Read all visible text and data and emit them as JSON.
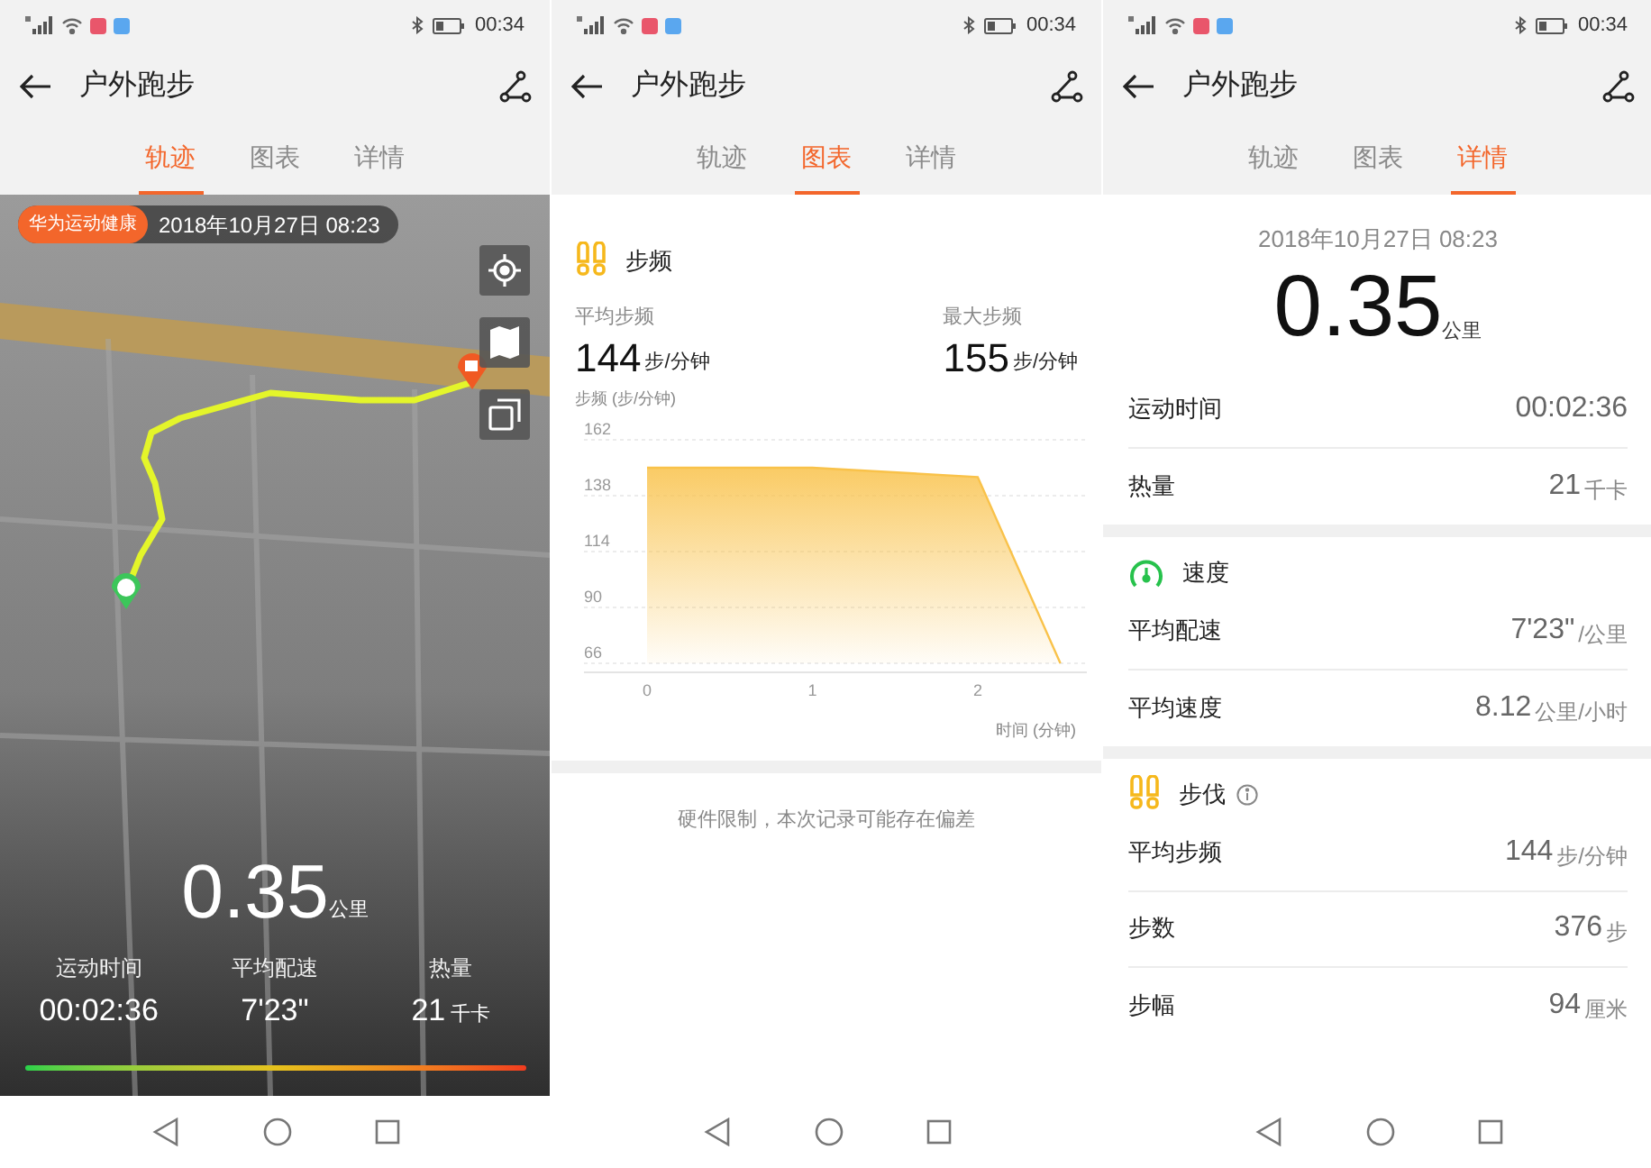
{
  "screens": [
    {
      "kind": "map",
      "status_bar": {
        "time": "00:34"
      },
      "header": {
        "title": "户外跑步"
      },
      "tabs": [
        {
          "label": "轨迹",
          "selected": true
        },
        {
          "label": "图表",
          "selected": false
        },
        {
          "label": "详情",
          "selected": false
        }
      ],
      "badge": "华为运动健康",
      "date": "2018年10月27日 08:23",
      "distance": "0.35",
      "distance_unit": "公里",
      "stats": [
        {
          "label": "运动时间",
          "value": "00:02:36"
        },
        {
          "label": "平均配速",
          "value": "7'23\""
        },
        {
          "label": "热量",
          "value": "21",
          "unit": "千卡"
        }
      ]
    },
    {
      "kind": "chart",
      "status_bar": {
        "time": "00:34"
      },
      "header": {
        "title": "户外跑步"
      },
      "tabs": [
        {
          "label": "轨迹",
          "selected": false
        },
        {
          "label": "图表",
          "selected": true
        },
        {
          "label": "详情",
          "selected": false
        }
      ],
      "section": {
        "title": "步频",
        "stats": [
          {
            "label": "平均步频",
            "value": "144",
            "unit": "步/分钟"
          },
          {
            "label": "最大步频",
            "value": "155",
            "unit": "步/分钟"
          }
        ],
        "chart_data": {
          "type": "area",
          "ylabel": "步频 (步/分钟)",
          "xlabel": "时间 (分钟)",
          "x": [
            0,
            1,
            2,
            2.5
          ],
          "series": [
            {
              "color": "#f9c24a",
              "values": [
                150,
                150,
                146,
                66
              ]
            }
          ],
          "xlim": [
            0,
            2.66
          ],
          "ylim": [
            66,
            162
          ],
          "xticks": [
            0,
            1,
            2
          ],
          "yticks": [
            66,
            90,
            114,
            138,
            162
          ],
          "grid": true
        }
      },
      "note": "硬件限制，本次记录可能存在偏差"
    },
    {
      "kind": "details",
      "status_bar": {
        "time": "00:34"
      },
      "header": {
        "title": "户外跑步"
      },
      "tabs": [
        {
          "label": "轨迹",
          "selected": false
        },
        {
          "label": "图表",
          "selected": false
        },
        {
          "label": "详情",
          "selected": true
        }
      ],
      "date": "2018年10月27日 08:23",
      "distance": "0.35",
      "distance_unit": "公里",
      "groups": [
        {
          "kind": "plain",
          "rows": [
            {
              "label": "运动时间",
              "value": "00:02:36"
            },
            {
              "label": "热量",
              "value": "21",
              "unit": "千卡"
            }
          ]
        },
        {
          "kind": "speed",
          "title": "速度",
          "rows": [
            {
              "label": "平均配速",
              "value": "7'23\"",
              "unit": "/公里"
            },
            {
              "label": "平均速度",
              "value": "8.12",
              "unit": "公里/小时"
            }
          ]
        },
        {
          "kind": "steps",
          "title": "步伐",
          "info": true,
          "rows": [
            {
              "label": "平均步频",
              "value": "144",
              "unit": "步/分钟"
            },
            {
              "label": "步数",
              "value": "376",
              "unit": "步"
            },
            {
              "label": "步幅",
              "value": "94",
              "unit": "厘米"
            }
          ]
        }
      ]
    }
  ]
}
